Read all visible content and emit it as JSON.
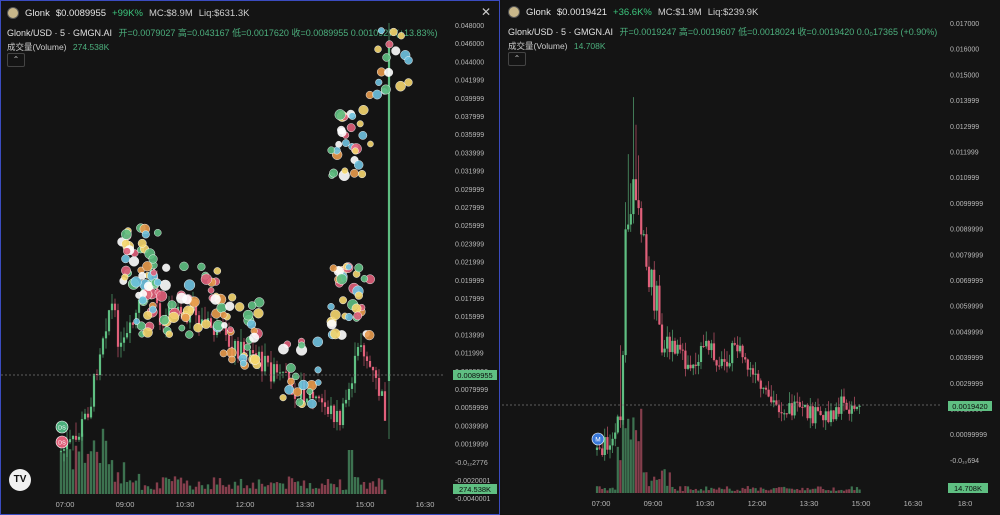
{
  "left": {
    "token": "Glonk",
    "price": "$0.0089955",
    "change": "+99K%",
    "mc": "MC:$8.9M",
    "liq": "Liq:$631.3K",
    "symbol": "Glonk/USD · 5 · GMGN.AI",
    "ohlc": "开=0.0079027 高=0.043167 低=0.0017620 收=0.0089955 0.0010927 (+13.83%)",
    "volume_label": "成交量(Volume)",
    "volume_value": "274.538K",
    "price_tag": "0.0089955",
    "volume_tag": "274.538K",
    "close": "✕",
    "collapse": "⌃",
    "y_ticks": [
      "0.048000",
      "0.046000",
      "0.044000",
      "0.041999",
      "0.039999",
      "0.037999",
      "0.035999",
      "0.033999",
      "0.031999",
      "0.029999",
      "0.027999",
      "0.025999",
      "0.023999",
      "0.021999",
      "0.019999",
      "0.017999",
      "0.015999",
      "0.013999",
      "0.011999",
      "0.0099999",
      "0.0079999",
      "0.0059999",
      "0.0039999",
      "0.0019999",
      "-0.0₁₂2776",
      "-0.0020001",
      "-0.0040001"
    ],
    "x_ticks": [
      "07:00",
      "09:00",
      "10:30",
      "12:00",
      "13:30",
      "15:00",
      "16:30"
    ],
    "markers": [
      "DS",
      "DS"
    ],
    "tv_logo": "TV"
  },
  "right": {
    "token": "Glonk",
    "price": "$0.0019421",
    "change": "+36.6K%",
    "mc": "MC:$1.9M",
    "liq": "Liq:$239.9K",
    "symbol": "Glonk/USD · 5 · GMGN.AI",
    "ohlc": "开=0.0019247 高=0.0019607 低=0.0018024 收=0.0019420 0.0₀17365 (+0.90%)",
    "volume_label": "成交量(Volume)",
    "volume_value": "14.708K",
    "price_tag": "0.0019420",
    "volume_tag": "14.708K",
    "collapse": "⌃",
    "y_ticks": [
      "0.017000",
      "0.016000",
      "0.015000",
      "0.013999",
      "0.012999",
      "0.011999",
      "0.010999",
      "0.0099999",
      "0.0089999",
      "0.0079999",
      "0.0069999",
      "0.0059999",
      "0.0049999",
      "0.0039999",
      "0.0029999",
      "0.0019999",
      "0.00099999",
      "-0.0₁₀694",
      "-0.0010001"
    ],
    "x_ticks": [
      "07:00",
      "09:00",
      "10:30",
      "12:00",
      "13:30",
      "15:00",
      "16:30",
      "18:0"
    ],
    "marker": "M"
  },
  "colors": {
    "up": "#5fbf82",
    "down": "#e0607a",
    "accent": "#3b4cc0",
    "tag": "#5fbf82"
  }
}
